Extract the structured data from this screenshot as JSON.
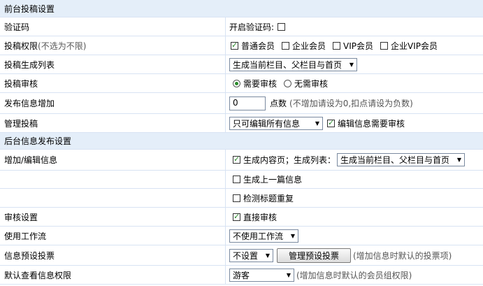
{
  "sections": {
    "front": "前台投稿设置",
    "back": "后台信息发布设置"
  },
  "captcha": {
    "label": "验证码",
    "option": "开启验证码:",
    "checked": false
  },
  "permission": {
    "label": "投稿权限",
    "hint": "(不选为不限)",
    "options": [
      {
        "text": "普通会员",
        "checked": true
      },
      {
        "text": "企业会员",
        "checked": false
      },
      {
        "text": "VIP会员",
        "checked": false
      },
      {
        "text": "企业VIP会员",
        "checked": false
      }
    ]
  },
  "gen_list": {
    "label": "投稿生成列表",
    "selected": "生成当前栏目、父栏目与首页"
  },
  "review": {
    "label": "投稿审核",
    "options": [
      {
        "text": "需要审核",
        "checked": true
      },
      {
        "text": "无需审核",
        "checked": false
      }
    ]
  },
  "points": {
    "label": "发布信息增加",
    "value": "0",
    "unit": "点数",
    "hint": "(不增加请设为0,扣点请设为负数)"
  },
  "manage": {
    "label": "管理投稿",
    "selected": "只可编辑所有信息",
    "check_text": "编辑信息需要审核",
    "checked": true
  },
  "addedit": {
    "label": "增加/编辑信息",
    "gen_content": "生成内容页；生成列表：",
    "gen_content_checked": true,
    "list_selected": "生成当前栏目、父栏目与首页",
    "prev": "生成上一篇信息",
    "prev_checked": false,
    "dup": "检测标题重复",
    "dup_checked": false
  },
  "audit": {
    "label": "审核设置",
    "text": "直接审核",
    "checked": true
  },
  "workflow": {
    "label": "使用工作流",
    "selected": "不使用工作流"
  },
  "vote": {
    "label": "信息预设投票",
    "selected": "不设置",
    "button": "管理预设投票",
    "hint": "(增加信息时默认的投票项)"
  },
  "viewperm": {
    "label": "默认查看信息权限",
    "selected": "游客",
    "hint": "(增加信息时默认的会员组权限)"
  }
}
